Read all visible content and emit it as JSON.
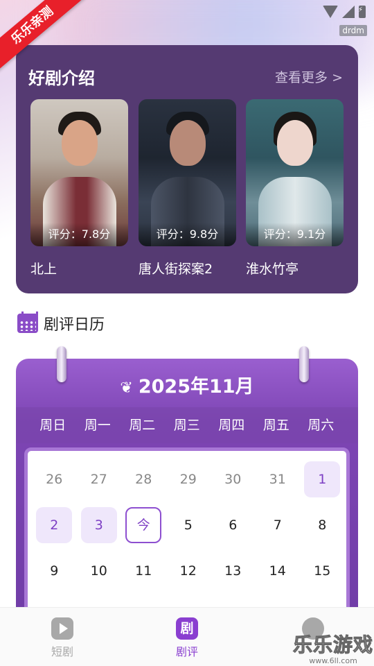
{
  "status_bar": {
    "carrier_tag": "drdm"
  },
  "ribbon": {
    "label": "乐乐亲测"
  },
  "intro": {
    "title": "好剧介绍",
    "more_label": "查看更多 >",
    "dramas": [
      {
        "score": "评分：7.8分",
        "name": "北上"
      },
      {
        "score": "评分：9.8分",
        "name": "唐人街探案2"
      },
      {
        "score": "评分：9.1分",
        "name": "淮水竹亭"
      }
    ]
  },
  "calendar_section": {
    "title": "剧评日历"
  },
  "calendar": {
    "month_label": "2025年11月",
    "weekdays": [
      "周日",
      "周一",
      "周二",
      "周三",
      "周四",
      "周五",
      "周六"
    ],
    "days": [
      [
        "26",
        "27",
        "28",
        "29",
        "30",
        "31",
        "1"
      ],
      [
        "2",
        "3",
        "今",
        "5",
        "6",
        "7",
        "8"
      ],
      [
        "9",
        "10",
        "11",
        "12",
        "13",
        "14",
        "15"
      ]
    ]
  },
  "bottom_nav": {
    "short_label": "短剧",
    "review_label": "剧评",
    "review_icon_text": "剧"
  },
  "watermark": {
    "main": "乐乐游戏",
    "sub": "www.6ll.com"
  }
}
